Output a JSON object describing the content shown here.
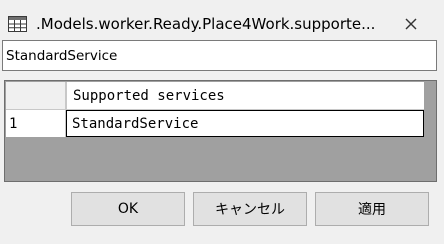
{
  "window": {
    "title": ".Models.worker.Ready.Place4Work.supporte...",
    "app_icon": "table-icon",
    "close_icon": "close-icon"
  },
  "field": {
    "value": "StandardService"
  },
  "grid": {
    "column_header": "Supported services",
    "rows": [
      {
        "index": "1",
        "value": "StandardService"
      }
    ]
  },
  "buttons": {
    "ok_label": "OK",
    "cancel_label": "キャンセル",
    "apply_label": "適用"
  }
}
